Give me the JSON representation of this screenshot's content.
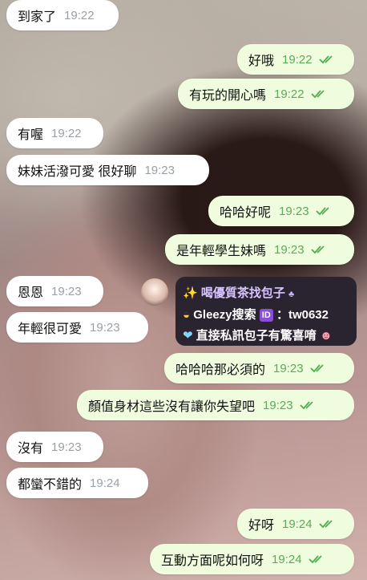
{
  "messages": [
    {
      "text": "到家了",
      "time": "19:22",
      "side": "in"
    },
    {
      "text": "好哦",
      "time": "19:22",
      "side": "out"
    },
    {
      "text": "有玩的開心嗎",
      "time": "19:22",
      "side": "out"
    },
    {
      "text": "有喔",
      "time": "19:22",
      "side": "in"
    },
    {
      "text": "妹妹活潑可愛 很好聊",
      "time": "19:23",
      "side": "in"
    },
    {
      "text": "哈哈好呢",
      "time": "19:23",
      "side": "out"
    },
    {
      "text": "是年輕學生妹嗎",
      "time": "19:23",
      "side": "out"
    },
    {
      "text": "恩恩",
      "time": "19:23",
      "side": "in"
    },
    {
      "text": "年輕很可愛",
      "time": "19:23",
      "side": "in"
    },
    {
      "text": "哈哈哈那必須的",
      "time": "19:23",
      "side": "out"
    },
    {
      "text": "顏值身材這些沒有讓你失望吧",
      "time": "19:23",
      "side": "out"
    },
    {
      "text": "沒有",
      "time": "19:23",
      "side": "in"
    },
    {
      "text": "都蠻不錯的",
      "time": "19:24",
      "side": "in"
    },
    {
      "text": "好呀",
      "time": "19:24",
      "side": "out"
    },
    {
      "text": "互動方面呢如何呀",
      "time": "19:24",
      "side": "out"
    }
  ],
  "ad": {
    "title": "喝優質茶找包子",
    "line2": "Gleezy搜索",
    "id_badge": "ID",
    "line2_value": "：tw0632",
    "line3": "直接私訊包子有驚喜唷"
  },
  "colors": {
    "incoming_bubble": "#ffffff",
    "outgoing_bubble": "#effdde",
    "check_color": "#4fae4e"
  }
}
